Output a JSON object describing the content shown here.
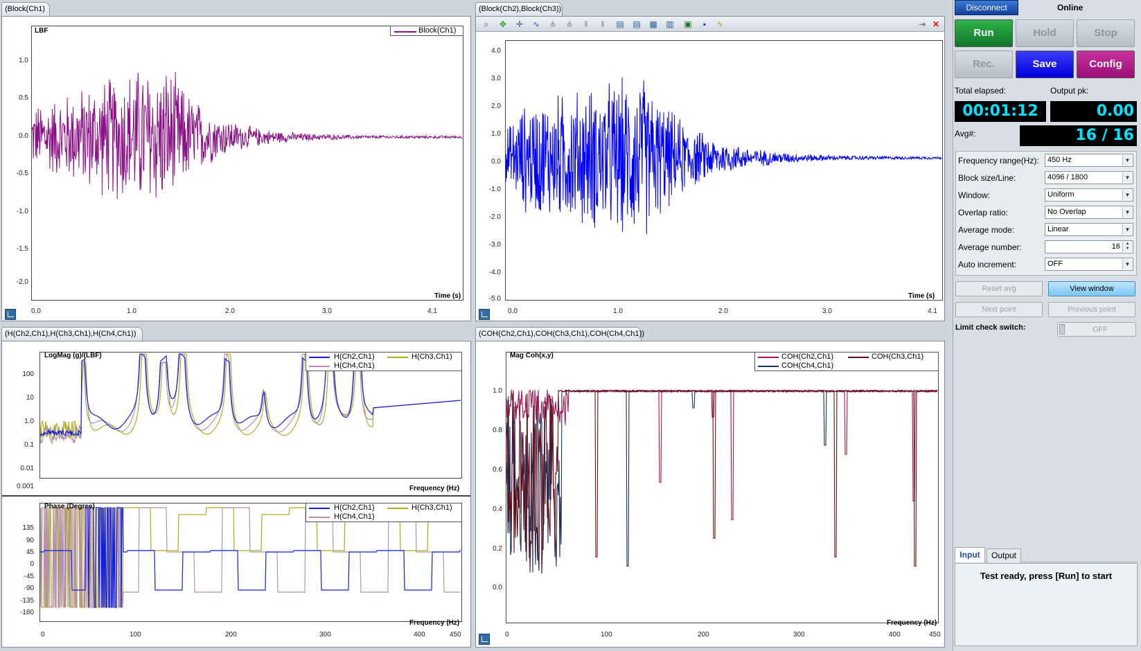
{
  "top_left": {
    "tab": "(Block(Ch1)",
    "ylabel": "LBF",
    "xlabel": "Time (s)",
    "legend": [
      "Block(Ch1)"
    ],
    "yticks": [
      "1.0",
      "0.5",
      "0.0",
      "-0.5",
      "-1.0",
      "-1.5",
      "-2.0"
    ],
    "xticks": [
      "0.0",
      "1.0",
      "2.0",
      "3.0",
      "4.1"
    ],
    "color": "#8b0f86"
  },
  "top_right": {
    "tab": "(Block(Ch2),Block(Ch3))",
    "xlabel": "Time (s)",
    "yticks": [
      "4.0",
      "3.0",
      "2.0",
      "1.0",
      "0.0",
      "-1.0",
      "-2.0",
      "-3.0",
      "-4.0",
      "-5.0"
    ],
    "xticks": [
      "0.0",
      "1.0",
      "2.0",
      "3.0",
      "4.1"
    ],
    "color": "#0000ff"
  },
  "bottom_left": {
    "tab": "(H(Ch2,Ch1),H(Ch3,Ch1),H(Ch4,Ch1))",
    "mag": {
      "ylabel": "LogMag (g)/(LBF)",
      "xlabel": "Frequency (Hz)",
      "yticks": [
        "100",
        "10",
        "1.0",
        "0.1",
        "0.01",
        "0.001"
      ]
    },
    "phase": {
      "ylabel": "Phase (Degree)",
      "xlabel": "Frequency (Hz)",
      "yticks": [
        "135",
        "90",
        "45",
        "0",
        "-45",
        "-90",
        "-135",
        "-180"
      ]
    },
    "legend": [
      "H(Ch2,Ch1)",
      "H(Ch3,Ch1)",
      "H(Ch4,Ch1)"
    ],
    "xticks": [
      "0",
      "100",
      "200",
      "300",
      "400",
      "450"
    ],
    "colors": [
      "#0f1fe6",
      "#b3ad1a",
      "#b58fb5"
    ]
  },
  "bottom_right": {
    "tab": "(COH(Ch2,Ch1),COH(Ch3,Ch1),COH(Ch4,Ch1))",
    "ylabel": "Mag Coh(x,y)",
    "xlabel": "Frequency (Hz)",
    "legend": [
      "COH(Ch2,Ch1)",
      "COH(Ch3,Ch1)",
      "COH(Ch4,Ch1)"
    ],
    "yticks": [
      "1.0",
      "0.8",
      "0.6",
      "0.4",
      "0.2",
      "0.0"
    ],
    "xticks": [
      "0",
      "100",
      "200",
      "300",
      "400",
      "450"
    ],
    "colors": [
      "#a3154f",
      "#6b0d14",
      "#1a2f5a"
    ]
  },
  "side": {
    "disconnect": "Disconnect",
    "status": "Online",
    "run": "Run",
    "hold": "Hold",
    "stop": "Stop",
    "rec": "Rec.",
    "save": "Save",
    "config": "Config",
    "total_elapsed_label": "Total elapsed:",
    "output_pk_label": "Output pk:",
    "total_elapsed": "00:01:12",
    "output_pk": "0.00",
    "avg_label": "Avg#:",
    "avg": "16 / 16",
    "settings": [
      {
        "label": "Frequency range(Hz):",
        "value": "450 Hz"
      },
      {
        "label": "Block size/Line:",
        "value": "4096 / 1800"
      },
      {
        "label": "Window:",
        "value": "Uniform"
      },
      {
        "label": "Overlap ratio:",
        "value": "No Overlap"
      },
      {
        "label": "Average mode:",
        "value": "Linear"
      },
      {
        "label": "Average number:",
        "value": "16"
      },
      {
        "label": "Auto increment:",
        "value": "OFF"
      }
    ],
    "reset_avg": "Reset avg",
    "view_window": "View window",
    "next_point": "Next point",
    "previous_point": "Previous point",
    "limit_label": "Limit check switch:",
    "limit_value": "OFF",
    "tab_input": "Input",
    "tab_output": "Output",
    "message": "Test ready, press [Run] to start"
  }
}
